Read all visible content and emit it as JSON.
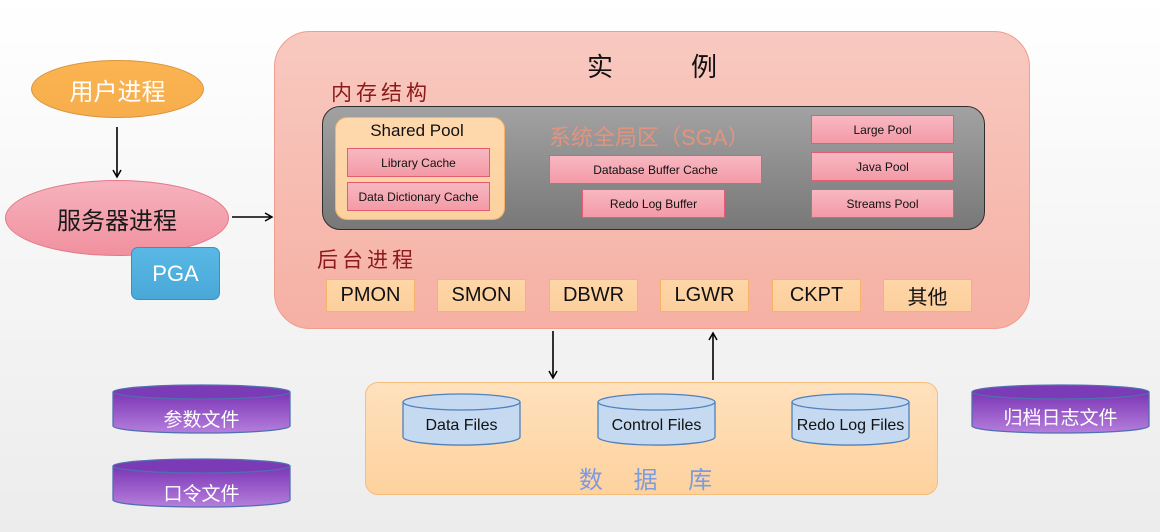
{
  "left": {
    "user_process": "用户进程",
    "server_process": "服务器进程",
    "pga": "PGA"
  },
  "instance": {
    "title_chars": [
      "实",
      "例"
    ],
    "memory_label": "内存结构",
    "sga": {
      "title": "系统全局区（SGA）",
      "shared_pool": {
        "title": "Shared Pool",
        "items": [
          "Library Cache",
          "Data Dictionary Cache"
        ]
      },
      "buffers": [
        "Database Buffer Cache",
        "Redo Log Buffer"
      ],
      "pools": [
        "Large Pool",
        "Java Pool",
        "Streams Pool"
      ]
    },
    "background_label": "后台进程",
    "background_processes": [
      "PMON",
      "SMON",
      "DBWR",
      "LGWR",
      "CKPT",
      "其他"
    ]
  },
  "database": {
    "title": "数 据 库",
    "files": [
      "Data Files",
      "Control Files",
      "Redo Log Files"
    ]
  },
  "external_files": [
    "参数文件",
    "口令文件",
    "归档日志文件"
  ],
  "colors": {
    "user_process": "#f7ad4c",
    "server_process": "#f1909f",
    "pga": "#4aa8d8",
    "instance": "#f6b0a4",
    "sga": "#787878",
    "database": "#fdd29e",
    "datafile_cylinder": "#c5d9f1",
    "external_cylinder": "#9b59c9"
  }
}
